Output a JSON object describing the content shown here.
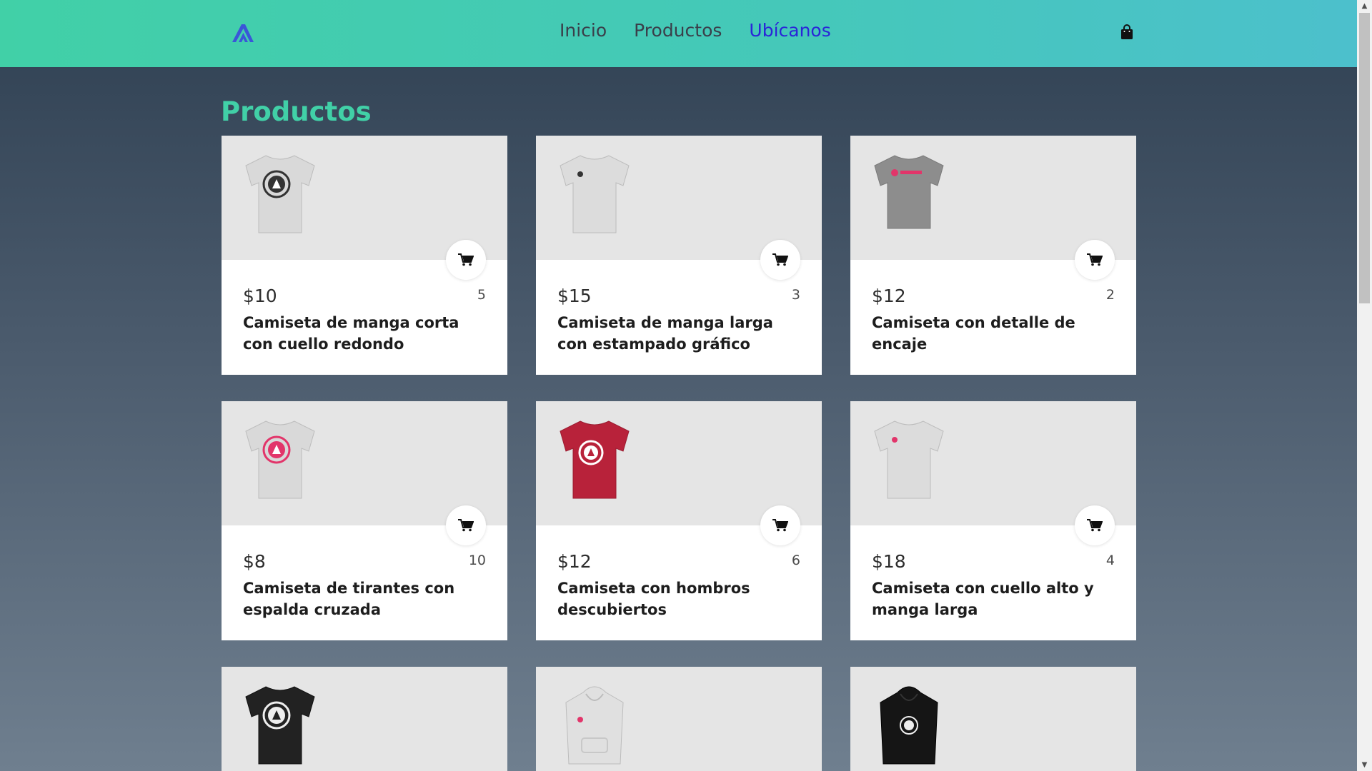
{
  "nav": {
    "links": [
      {
        "label": "Inicio",
        "active": false
      },
      {
        "label": "Productos",
        "active": false
      },
      {
        "label": "Ubícanos",
        "active": true
      }
    ],
    "logo_icon": "academlo-logo-icon",
    "cart_icon": "shopping-bag-icon"
  },
  "colors": {
    "accent": "#41d0a7",
    "nav_active": "#2a25d8",
    "shirt_white": "#d9d9d9",
    "shirt_gray": "#8d8d8d",
    "shirt_red": "#b8223a",
    "shirt_black": "#222222",
    "brand_pink": "#e2356a"
  },
  "main": {
    "title": "Productos",
    "products": [
      {
        "price": "$10",
        "stock": "5",
        "name": "Camiseta de manga corta con cuello redondo",
        "image": "white-tshirt-black-logo"
      },
      {
        "price": "$15",
        "stock": "3",
        "name": "Camiseta de manga larga con estampado gráfico",
        "image": "white-tshirt-small-logo"
      },
      {
        "price": "$12",
        "stock": "2",
        "name": "Camiseta con detalle de encaje",
        "image": "gray-tshirt-pink-text"
      },
      {
        "price": "$8",
        "stock": "10",
        "name": "Camiseta de tirantes con espalda cruzada",
        "image": "white-tshirt-pink-logo"
      },
      {
        "price": "$12",
        "stock": "6",
        "name": "Camiseta con hombros descubiertos",
        "image": "red-tshirt-white-logo"
      },
      {
        "price": "$18",
        "stock": "4",
        "name": "Camiseta con cuello alto y manga larga",
        "image": "white-tshirt-small-pink-logo"
      },
      {
        "price": "",
        "stock": "",
        "name": "",
        "image": "black-tshirt-white-logo"
      },
      {
        "price": "",
        "stock": "",
        "name": "",
        "image": "white-hoodie-pink-logo"
      },
      {
        "price": "",
        "stock": "",
        "name": "",
        "image": "black-hoodie-white-logo"
      }
    ]
  }
}
